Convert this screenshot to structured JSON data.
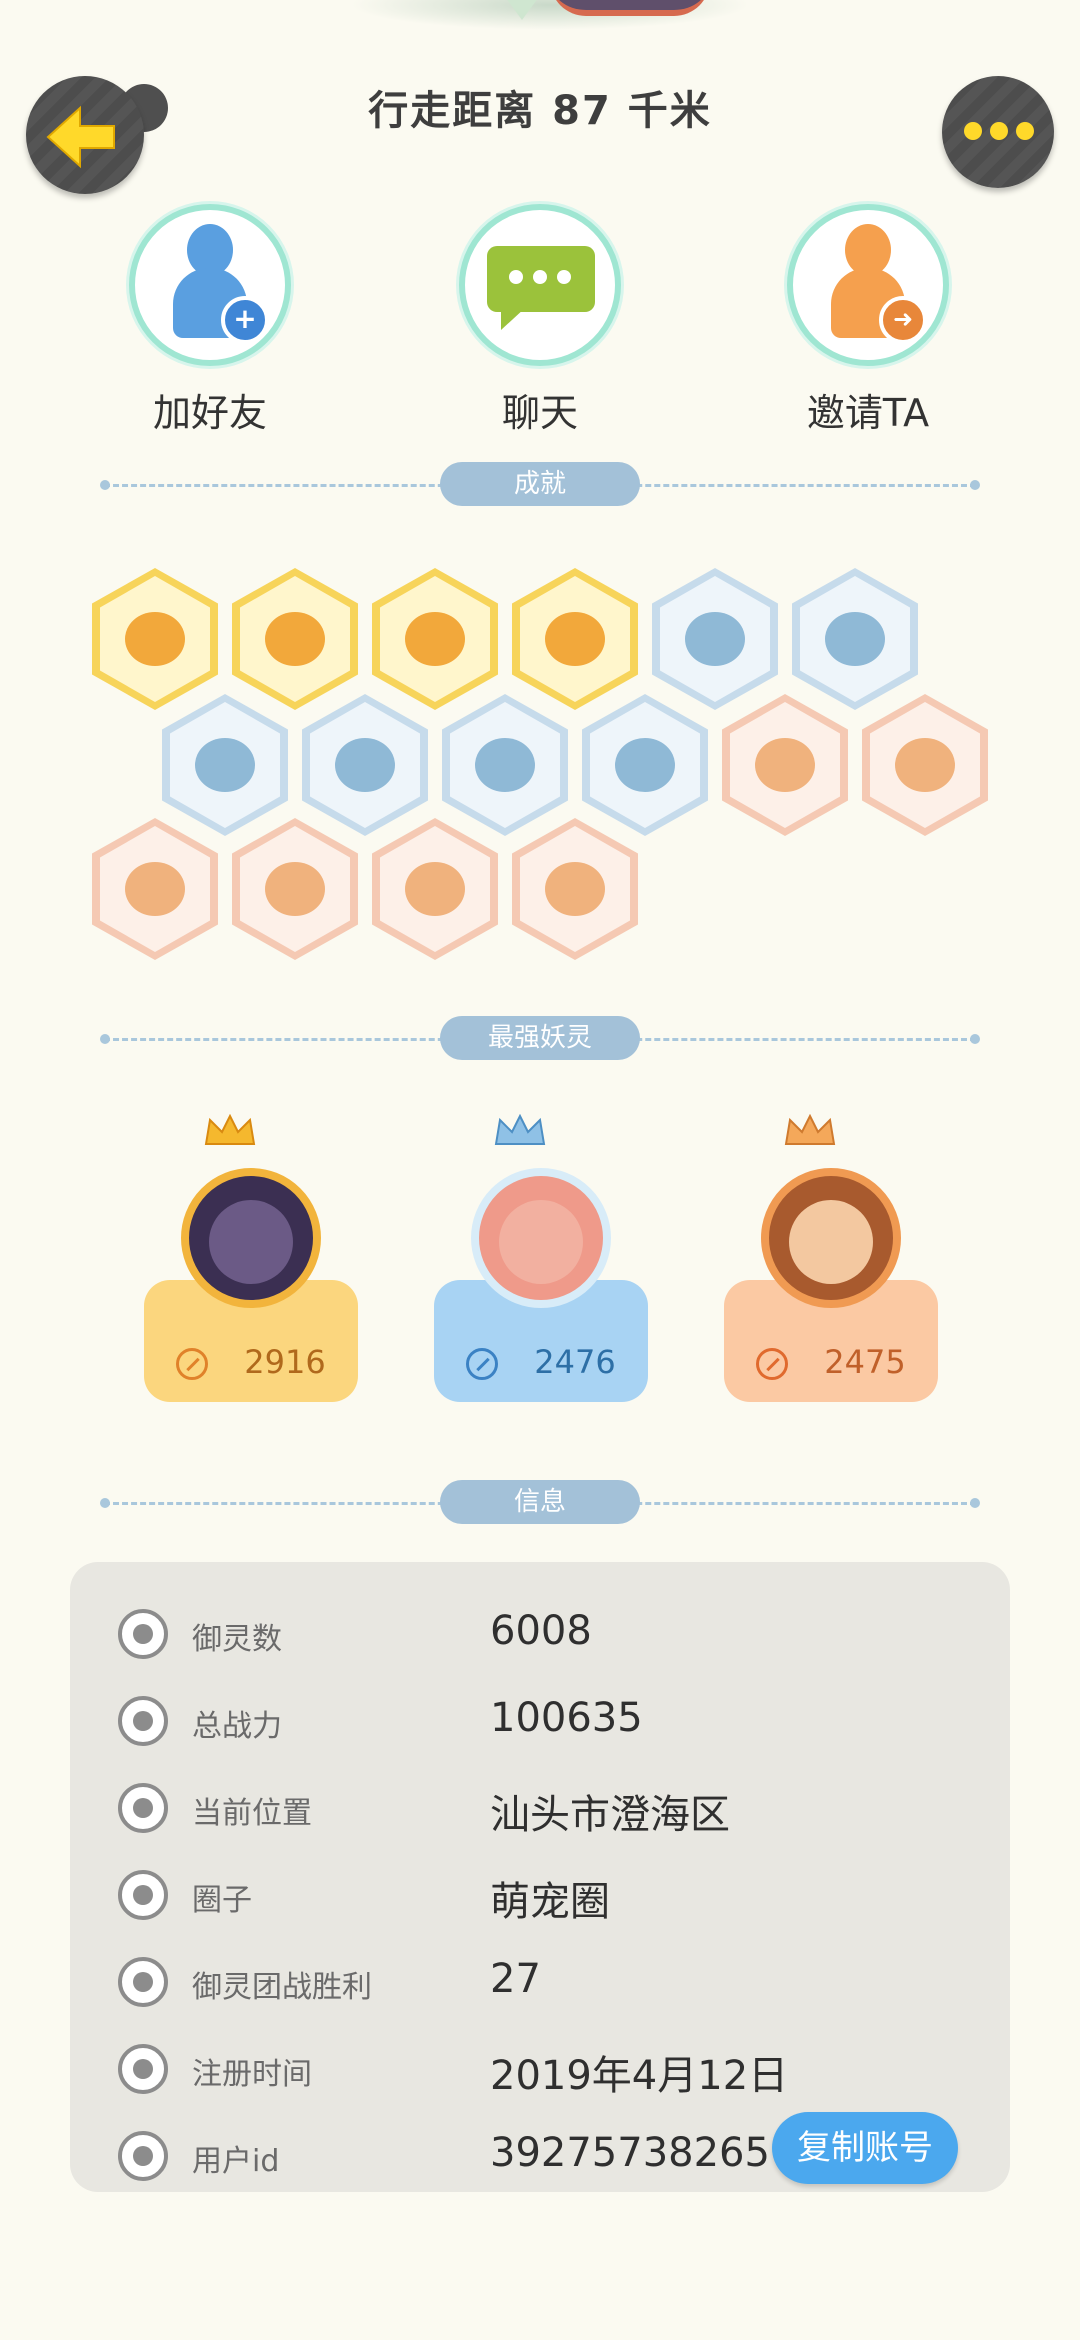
{
  "header": {
    "title": "行走距离 87 千米"
  },
  "actions": [
    {
      "label": "加好友"
    },
    {
      "label": "聊天"
    },
    {
      "label": "邀请TA"
    }
  ],
  "sections": {
    "achievements": "成就",
    "strongest": "最强妖灵",
    "info": "信息"
  },
  "achievements": {
    "tiers": [
      "gold",
      "gold",
      "gold",
      "gold",
      "blue",
      "blue",
      "blue",
      "blue",
      "blue",
      "blue",
      "peach",
      "peach",
      "peach",
      "peach",
      "peach",
      "peach"
    ]
  },
  "pets": [
    {
      "power": "2916",
      "theme": "gold"
    },
    {
      "power": "2476",
      "theme": "blue"
    },
    {
      "power": "2475",
      "theme": "orange"
    }
  ],
  "info": {
    "rows": [
      {
        "label": "御灵数",
        "value": "6008",
        "icon": "spirit-icon"
      },
      {
        "label": "总战力",
        "value": "100635",
        "icon": "sword-icon"
      },
      {
        "label": "当前位置",
        "value": "汕头市澄海区",
        "icon": "location-icon"
      },
      {
        "label": "圈子",
        "value": "萌宠圈",
        "icon": "circle-icon"
      },
      {
        "label": "御灵团战胜利",
        "value": "27",
        "icon": "trophy-icon"
      },
      {
        "label": "注册时间",
        "value": "2019年4月12日",
        "icon": "clock-icon"
      },
      {
        "label": "用户id",
        "value": "39275738265",
        "icon": "id-icon"
      }
    ],
    "copy_button": "复制账号"
  },
  "colors": {
    "background": "#fbfaf1",
    "accent_blue": "#4ba8ee",
    "gold": "#f7d45a",
    "divider": "#a3c1d8"
  }
}
